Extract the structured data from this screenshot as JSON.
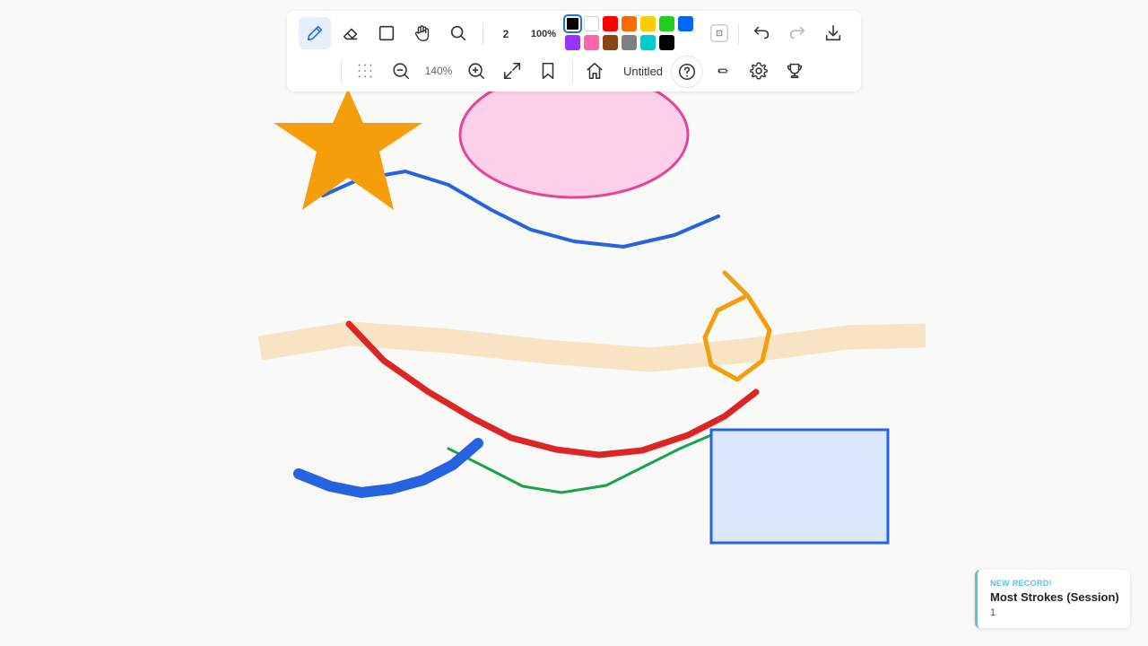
{
  "toolbar": {
    "row1": {
      "tools": [
        {
          "name": "pen-tool",
          "icon": "pencil-icon",
          "active": true
        },
        {
          "name": "eraser-tool",
          "icon": "eraser-icon",
          "active": false
        },
        {
          "name": "rectangle-tool",
          "icon": "square-icon",
          "active": false
        },
        {
          "name": "pan-tool",
          "icon": "hand-icon",
          "active": false
        },
        {
          "name": "search-tool",
          "icon": "search-icon",
          "active": false
        }
      ],
      "stroke_width": "2",
      "opacity": "100%",
      "palette": [
        {
          "color": "#000000",
          "selected": true
        },
        {
          "color": "#ffffff",
          "selected": false
        },
        {
          "color": "#ff0000",
          "selected": false
        },
        {
          "color": "#ff6a00",
          "selected": false
        },
        {
          "color": "#ffcc00",
          "selected": false
        },
        {
          "color": "#22cc22",
          "selected": false
        },
        {
          "color": "#0066ff",
          "selected": false
        },
        {
          "color": "#9933ff",
          "selected": false
        },
        {
          "color": "#ff66aa",
          "selected": false
        },
        {
          "color": "#8b4513",
          "selected": false
        },
        {
          "color": "#808080",
          "selected": false
        },
        {
          "color": "#00cccc",
          "selected": false
        },
        {
          "color": "#000000",
          "selected": false
        }
      ],
      "actions": [
        "fill-toggle-icon",
        "undo-icon",
        "redo-icon",
        "download-icon"
      ]
    },
    "row2": {
      "grid_icon": "grid-dots-icon",
      "zoom_out_icon": "zoom-out-icon",
      "zoom_level": "140%",
      "zoom_in_icon": "zoom-in-icon",
      "fit_icon": "expand-icon",
      "bookmark_icon": "bookmark-icon",
      "home_icon": "home-icon",
      "document_title": "Untitled",
      "help_icon": "help-circle-icon",
      "misc_icon": "shape-swap-icon",
      "settings_icon": "gear-icon",
      "trophy_icon": "trophy-icon"
    }
  },
  "canvas": {
    "strokes": [
      {
        "kind": "pen",
        "color": "#f8e3c4",
        "width": 28
      },
      {
        "kind": "pen",
        "color": "#2563e0",
        "width": 4
      },
      {
        "kind": "star",
        "color": "#f59e0b"
      },
      {
        "kind": "ellipse",
        "stroke": "#e84393",
        "fill": "#fbd0e8"
      },
      {
        "kind": "pen",
        "color": "#dc2626",
        "width": 7
      },
      {
        "kind": "pen",
        "color": "#f59e0b",
        "width": 5
      },
      {
        "kind": "pen",
        "color": "#16a34a",
        "width": 3
      },
      {
        "kind": "pen",
        "color": "#2563e0",
        "width": 12
      },
      {
        "kind": "rect",
        "stroke": "#2563e0",
        "fill": "#dbe8fc"
      }
    ]
  },
  "toast": {
    "kicker": "NEW RECORD!",
    "title": "Most Strokes (Session)",
    "value": "1",
    "accent": "#5bc0de"
  }
}
